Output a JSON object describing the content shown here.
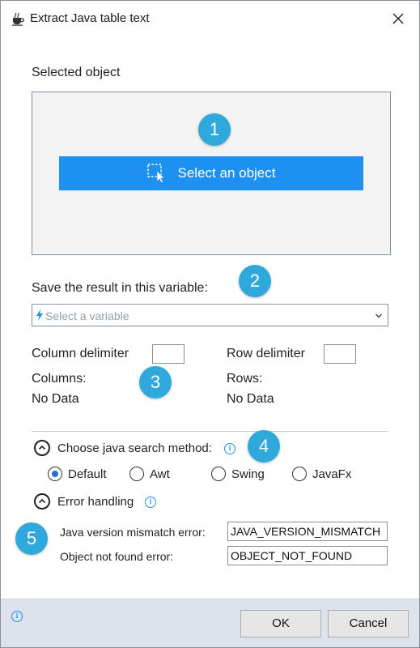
{
  "window": {
    "title": "Extract Java table text"
  },
  "selected_object": {
    "heading": "Selected object",
    "select_button_label": "Select an object"
  },
  "variable": {
    "heading": "Save the result in this variable:",
    "placeholder": "Select a variable"
  },
  "delimiters": {
    "column_label": "Column delimiter",
    "row_label": "Row delimiter",
    "column_value": "",
    "row_value": ""
  },
  "columns": {
    "label": "Columns:",
    "value": "No Data"
  },
  "rows": {
    "label": "Rows:",
    "value": "No Data"
  },
  "search_method": {
    "heading": "Choose java search method:",
    "options": [
      "Default",
      "Awt",
      "Swing",
      "JavaFx"
    ],
    "selected": "Default"
  },
  "error_handling": {
    "heading": "Error handling",
    "version_mismatch_label": "Java version mismatch error:",
    "version_mismatch_value": "JAVA_VERSION_MISMATCH",
    "not_found_label": "Object not found error:",
    "not_found_value": "OBJECT_NOT_FOUND"
  },
  "badges": [
    "1",
    "2",
    "3",
    "4",
    "5"
  ],
  "footer": {
    "ok_label": "OK",
    "cancel_label": "Cancel"
  },
  "colors": {
    "accent": "#1e90f0",
    "badge": "#2fa8dc",
    "footer_bg": "#dce3ec",
    "radio_fill": "#1e73d8"
  }
}
